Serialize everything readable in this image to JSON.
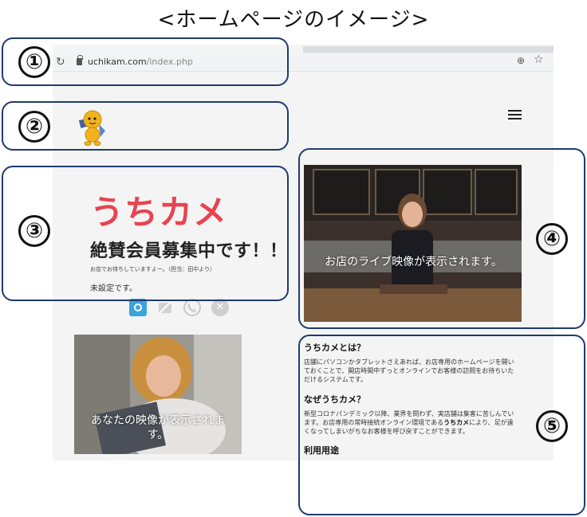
{
  "heading": "<ホームページのイメージ>",
  "browser": {
    "url_host": "uchikam.com",
    "url_path": "/index.php",
    "reload_icon": "reload-icon",
    "zoom_icon": "zoom-icon",
    "star_icon": "star-icon"
  },
  "hero": {
    "brand": "うちカメ",
    "recruit": "絶賛会員募集中です！！",
    "welcome": "お店でお待ちしていますよー。（担当：田中より）",
    "status": "未設定です。"
  },
  "controls": [
    "camera-icon",
    "camera-off-icon",
    "phone-icon",
    "close-icon"
  ],
  "videos": {
    "store_caption": "お店のライブ映像が表示されます。",
    "self_caption": "あなたの映像が表示されます。"
  },
  "info": {
    "about_title": "うちカメとは？",
    "about_text": "店舗にパソコンかタブレットさえあれば、お店専用のホームページを開いておくことで、開店時間中ずっとオンラインでお客様の訪問をお待ちいただけるシステムです。",
    "why_title": "なぜうちカメ？",
    "why_text_before": "新型コロナパンデミック以降、業界を問わず、実店舗は集客に苦しんでいます。お店専用の常時接続オンライン環境である",
    "why_text_bold": "うちカメ",
    "why_text_after": "により、足が遠くなってしまいがちなお客様を呼び戻すことができます。",
    "usage_title": "利用用途"
  },
  "annotations": {
    "n1": "①",
    "n2": "②",
    "n3": "③",
    "n4": "④",
    "n5": "⑤"
  },
  "colors": {
    "brand_red": "#e8434f",
    "annotation_border": "#1f3b6f",
    "camera_blue": "#3ba4dc"
  }
}
